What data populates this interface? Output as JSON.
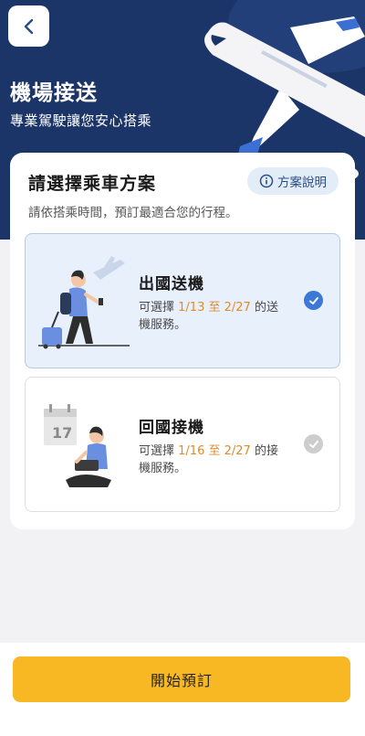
{
  "header": {
    "title": "機場接送",
    "subtitle": "專業駕駛讓您安心搭乘"
  },
  "plan": {
    "title": "請選擇乘車方案",
    "info_label": "方案說明",
    "description": "請依搭乘時間，預訂最適合您的行程。"
  },
  "options": [
    {
      "title": "出國送機",
      "desc_prefix": "可選擇 ",
      "date_from": "1/13",
      "date_sep": " 至 ",
      "date_to": "2/27",
      "desc_suffix": " 的送機服務。",
      "selected": true
    },
    {
      "title": "回國接機",
      "desc_prefix": "可選擇 ",
      "date_from": "1/16",
      "date_sep": " 至 ",
      "date_to": "2/27",
      "desc_suffix": " 的接機服務。",
      "calendar_day": "17",
      "selected": false
    }
  ],
  "cta": {
    "label": "開始預訂"
  },
  "colors": {
    "hero": "#1c3568",
    "accent_orange": "#e08a2d",
    "check_blue": "#3b78d8",
    "cta_yellow": "#f7b824"
  },
  "icons": {
    "back": "chevron-left-icon",
    "info": "info-icon",
    "check": "check-icon"
  }
}
